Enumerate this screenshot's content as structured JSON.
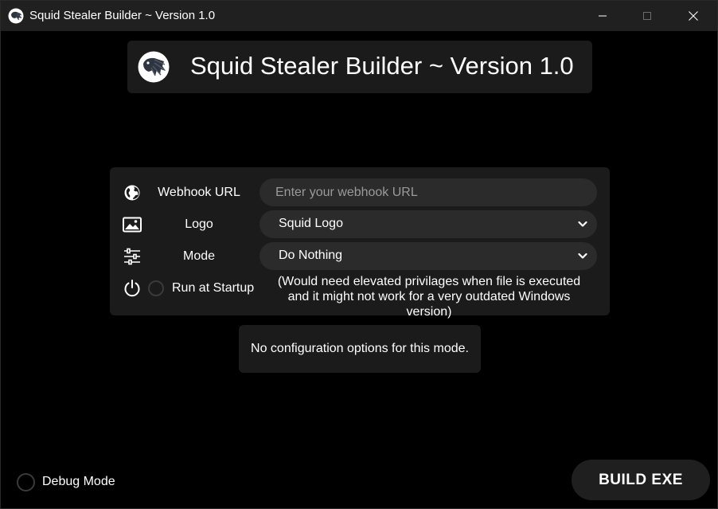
{
  "window": {
    "title": "Squid Stealer Builder ~ Version 1.0",
    "icon": "squid-logo-icon",
    "controls": [
      "minimize",
      "maximize",
      "close"
    ]
  },
  "header": {
    "title": "Squid Stealer Builder ~ Version 1.0",
    "logo": "squid-logo-icon"
  },
  "form": {
    "webhook": {
      "label": "Webhook URL",
      "icon": "globe-icon",
      "value": "",
      "placeholder": "Enter your webhook URL"
    },
    "logo": {
      "label": "Logo",
      "icon": "image-icon",
      "selected": "Squid Logo"
    },
    "mode": {
      "label": "Mode",
      "icon": "sliders-icon",
      "selected": "Do Nothing"
    },
    "startup": {
      "label": "Run at Startup",
      "icon": "power-icon",
      "checked": false,
      "note": "(Would need elevated privilages when file is executed and it might not work for a very outdated Windows version)"
    }
  },
  "config": {
    "message": "No configuration options for this mode."
  },
  "footer": {
    "debug_label": "Debug Mode",
    "debug_checked": false,
    "build_label": "BUILD EXE"
  },
  "colors": {
    "background": "#000000",
    "titlebar": "#202020",
    "panel": "#1b1b1b",
    "field": "#2b2b2b",
    "text": "#ffffff",
    "placeholder": "#9a9a9a"
  }
}
